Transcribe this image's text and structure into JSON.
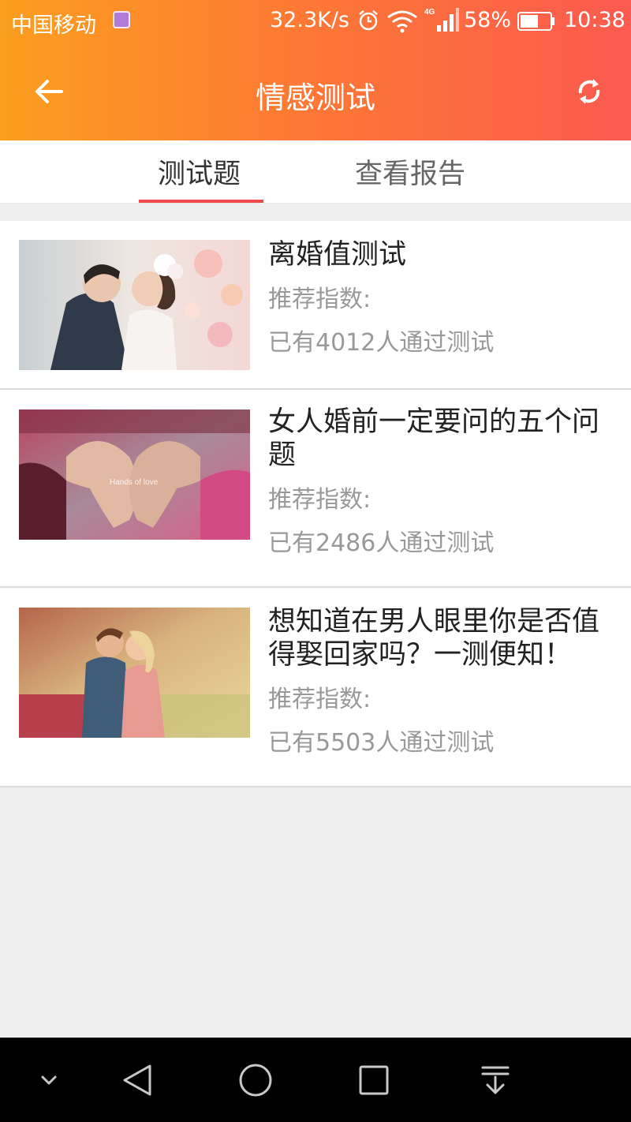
{
  "status_bar": {
    "carrier": "中国移动",
    "speed": "32.3K/s",
    "network": "4G",
    "battery": "58%",
    "time": "10:38"
  },
  "toolbar": {
    "title": "情感测试"
  },
  "tabs": [
    {
      "label": "测试题",
      "active": true
    },
    {
      "label": "查看报告",
      "active": false
    }
  ],
  "tests": [
    {
      "title": "离婚值测试",
      "rating_label": "推荐指数:",
      "count_text": "已有4012人通过测试"
    },
    {
      "title": "女人婚前一定要问的五个问题",
      "rating_label": "推荐指数:",
      "count_text": "已有2486人通过测试",
      "image_caption": "Hands of love"
    },
    {
      "title": "想知道在男人眼里你是否值得娶回家吗？一测便知！",
      "rating_label": "推荐指数:",
      "count_text": "已有5503人通过测试"
    }
  ],
  "colors": {
    "header_start": "#fb9f1f",
    "header_end": "#fb5a4f",
    "tab_indicator": "#f04a4a"
  }
}
